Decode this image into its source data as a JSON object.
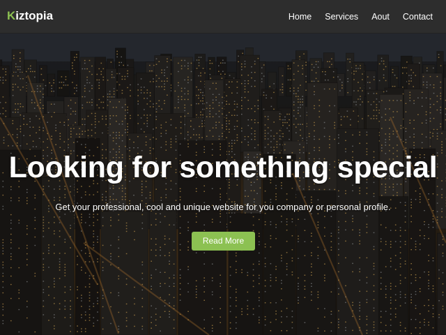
{
  "brand": {
    "first_letter": "K",
    "rest": "iztopia"
  },
  "nav": {
    "items": [
      "Home",
      "Services",
      "Aout",
      "Contact"
    ]
  },
  "hero": {
    "headline": "Looking for something special",
    "subline": "Get your professional, cool and unique website for you company or personal profile.",
    "cta_label": "Read More",
    "background_image": "night-city-skyline"
  },
  "colors": {
    "accent": "#8cc152",
    "navbar_bg": "#2d2d2d",
    "text": "#ffffff"
  }
}
